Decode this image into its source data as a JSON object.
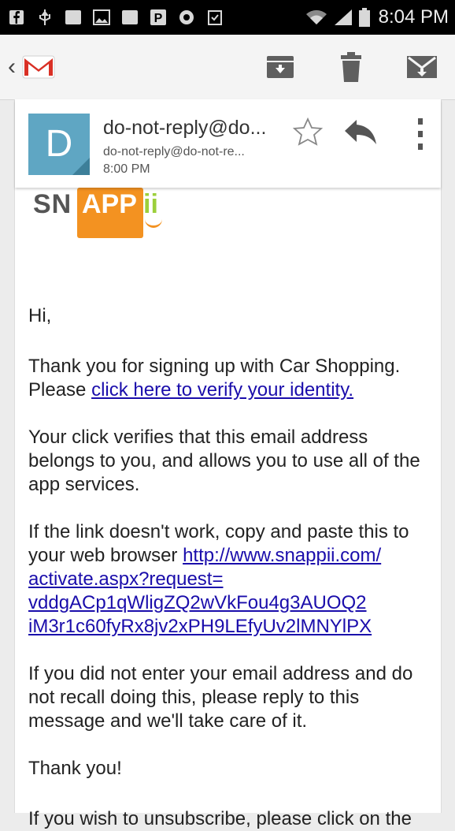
{
  "status_bar": {
    "time": "8:04 PM",
    "icons": [
      "facebook-icon",
      "usb-icon",
      "battery-full-icon",
      "gallery-icon",
      "snappii-icon",
      "p-icon",
      "photo-icon",
      "clipboard-check-icon",
      "wifi-icon",
      "signal-icon",
      "battery-icon"
    ]
  },
  "app_bar": {
    "back_icon": "chevron-left-icon",
    "logo_icon": "gmail-icon",
    "actions": [
      "archive-icon",
      "delete-icon",
      "mark-unread-icon"
    ]
  },
  "message": {
    "avatar_letter": "D",
    "sender_name": "do-not-reply@do...",
    "sender_email": "do-not-reply@do-not-re...",
    "time": "8:00 PM",
    "icons": {
      "star": "star-icon",
      "reply": "reply-icon",
      "more": "more-vert-icon"
    },
    "logo": {
      "part1": "SN",
      "part2": "APP",
      "part3": "ii"
    },
    "greeting": "Hi,",
    "p1_text": "Thank you for signing up with Car Shopping. Please ",
    "p1_link": "click here to verify your identity.",
    "p2": "Your click verifies that this email address belongs to you, and allows you to use all of the app services.",
    "p3_text": "If the link doesn't work, copy and paste this to your web browser ",
    "p3_link_lines": [
      "http://www.snappii.com/",
      "activate.aspx?request=",
      "vddgACp1qWligZQ2wVkFou4g3AUOQ2",
      "iM3r1c60fyRx8jv2xPH9LEfyUv2lMNYlPX"
    ],
    "p4": "If you did not enter your email address and do not recall doing this, please reply to this message and we'll take care of it.",
    "thanks": "Thank you!",
    "p5": "If you wish to unsubscribe, please click on the"
  },
  "colors": {
    "avatar": "#5fa6c3",
    "link": "#1a0dab",
    "brand_orange": "#f39221",
    "brand_green": "#9ccf3c"
  }
}
